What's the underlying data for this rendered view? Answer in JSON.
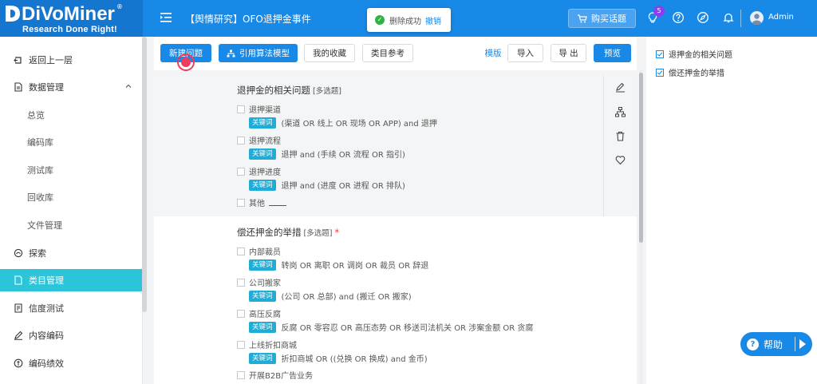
{
  "header": {
    "logo_text": "DiVoMiner",
    "logo_reg": "®",
    "logo_tagline": "Research Done Right!",
    "page_title": "【舆情研究】OFO退押金事件",
    "toast": {
      "message": "删除成功",
      "undo_label": "撤销"
    },
    "buy_button": "购买话题",
    "notification_count": "5",
    "user_name": "Admin"
  },
  "sidebar": {
    "items": [
      {
        "label": "返回上一层",
        "icon": "back-icon"
      },
      {
        "label": "数据管理",
        "icon": "data-icon"
      },
      {
        "label": "总览"
      },
      {
        "label": "编码库"
      },
      {
        "label": "测试库"
      },
      {
        "label": "回收库"
      },
      {
        "label": "文件管理"
      },
      {
        "label": "探索",
        "icon": "explore-icon"
      },
      {
        "label": "类目管理",
        "icon": "category-icon"
      },
      {
        "label": "信度测试",
        "icon": "reliability-icon"
      },
      {
        "label": "内容编码",
        "icon": "coding-icon"
      },
      {
        "label": "编码绩效",
        "icon": "performance-icon"
      }
    ]
  },
  "toolbar": {
    "new_question": "新建问题",
    "cite_model": "引用算法模型",
    "my_favorites": "我的收藏",
    "category_ref": "类目参考",
    "template": "模版",
    "import": "导入",
    "export": "导 出",
    "preview": "预览"
  },
  "questions": [
    {
      "title": "退押金的相关问题",
      "type": "[多选题]",
      "required": "",
      "options": [
        {
          "label": "退押渠道",
          "keyword_tag": "关键词",
          "keyword": "(渠道 OR 线上 OR 现场 OR APP) and 退押"
        },
        {
          "label": "退押流程",
          "keyword_tag": "关键词",
          "keyword": "退押 and (手续 OR 流程 OR 指引)"
        },
        {
          "label": "退押进度",
          "keyword_tag": "关键词",
          "keyword": "退押 and (进度 OR 进程 OR 排队)"
        },
        {
          "label": "其他"
        }
      ]
    },
    {
      "title": "偿还押金的举措",
      "type": "[多选题]",
      "required": "*",
      "options": [
        {
          "label": "内部裁员",
          "keyword_tag": "关键词",
          "keyword": "转岗 OR 离职 OR 调岗 OR 裁员 OR 辞退"
        },
        {
          "label": "公司搬家",
          "keyword_tag": "关键词",
          "keyword": "(公司 OR 总部) and (搬迁 OR 搬家)"
        },
        {
          "label": "高压反腐",
          "keyword_tag": "关键词",
          "keyword": "反腐 OR 零容忍 OR 高压态势 OR 移送司法机关 OR 涉案金额 OR 贪腐"
        },
        {
          "label": "上线折扣商城",
          "keyword_tag": "关键词",
          "keyword": "折扣商城 OR ((兑换 OR 换成) and 金币)"
        },
        {
          "label": "开展B2B广告业务"
        }
      ]
    }
  ],
  "right_panel": {
    "items": [
      "退押金的相关问题",
      "偿还押金的举措"
    ]
  },
  "help_button": "帮助",
  "colors": {
    "brand": "#1989e8",
    "active_nav": "#2bc4d9",
    "keyword_tag": "#1facd7",
    "required": "#e83b3b"
  }
}
